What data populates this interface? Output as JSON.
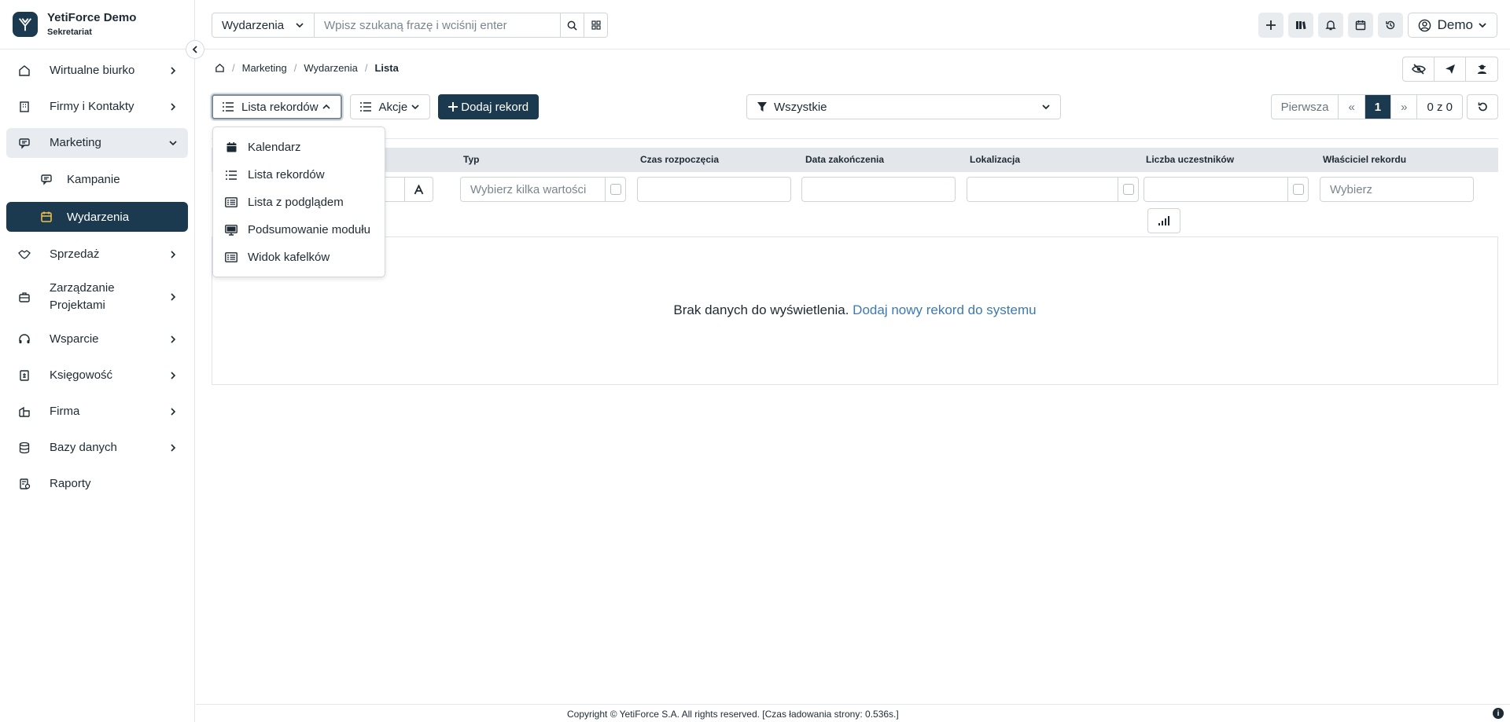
{
  "brand": {
    "name": "YetiForce Demo",
    "subtitle": "Sekretariat"
  },
  "sidebar": {
    "items": [
      {
        "label": "Wirtualne biurko",
        "icon": "home-icon"
      },
      {
        "label": "Firmy i Kontakty",
        "icon": "building-icon"
      },
      {
        "label": "Marketing",
        "icon": "megaphone-icon",
        "open": true,
        "children": [
          {
            "label": "Kampanie",
            "icon": "campaign-icon"
          },
          {
            "label": "Wydarzenia",
            "icon": "calendar-icon",
            "active": true
          }
        ]
      },
      {
        "label": "Sprzedaż",
        "icon": "handshake-icon"
      },
      {
        "label": "Zarządzanie Projektami",
        "icon": "briefcase-icon"
      },
      {
        "label": "Wsparcie",
        "icon": "headset-icon"
      },
      {
        "label": "Księgowość",
        "icon": "accounting-icon"
      },
      {
        "label": "Firma",
        "icon": "company-icon"
      },
      {
        "label": "Bazy danych",
        "icon": "database-icon"
      },
      {
        "label": "Raporty",
        "icon": "reports-icon"
      }
    ]
  },
  "header": {
    "search_module": "Wydarzenia",
    "search_placeholder": "Wpisz szukaną frazę i wciśnij enter",
    "user_label": "Demo"
  },
  "breadcrumb": {
    "items": [
      "Marketing",
      "Wydarzenia"
    ],
    "current": "Lista"
  },
  "toolbar": {
    "view_label": "Lista rekordów",
    "actions_label": "Akcje",
    "add_label": "Dodaj rekord",
    "filter_value": "Wszystkie"
  },
  "pager": {
    "first": "Pierwsza",
    "prev": "«",
    "current": "1",
    "next": "»",
    "count": "0 z 0"
  },
  "view_menu": {
    "items": [
      {
        "label": "Kalendarz",
        "icon": "calendar-icon"
      },
      {
        "label": "Lista rekordów",
        "icon": "list-icon"
      },
      {
        "label": "Lista z podglądem",
        "icon": "list-preview-icon"
      },
      {
        "label": "Podsumowanie modułu",
        "icon": "monitor-icon"
      },
      {
        "label": "Widok kafelków",
        "icon": "tiles-icon"
      }
    ]
  },
  "table": {
    "columns": [
      "Typ",
      "Czas rozpoczęcia",
      "Data zakończenia",
      "Lokalizacja",
      "Liczba uczestników",
      "Właściciel rekordu"
    ],
    "filter_placeholders": {
      "type": "Wybierz kilka wartości",
      "owner": "Wybierz"
    },
    "empty_text": "Brak danych do wyświetlenia.",
    "empty_link": "Dodaj nowy rekord do systemu"
  },
  "footer": {
    "text": "Copyright © YetiForce S.A. All rights reserved. [Czas ładowania strony: 0.536s.]"
  },
  "colors": {
    "primary": "#1b3a4f",
    "link": "#3d79b0",
    "header_bg": "#e3e7eb"
  }
}
